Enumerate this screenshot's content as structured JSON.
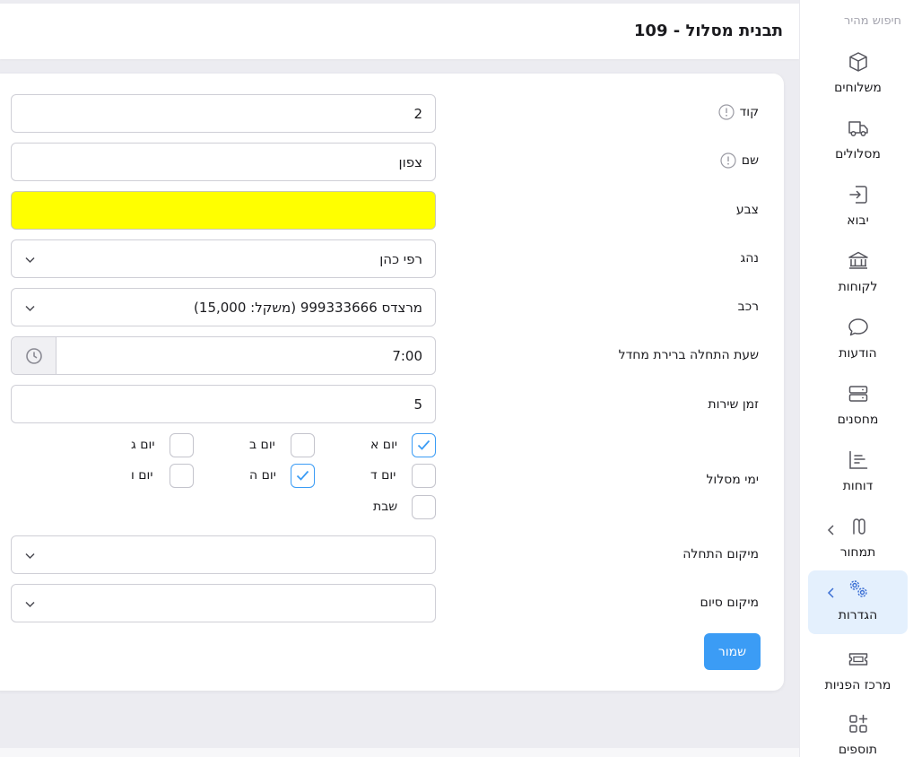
{
  "header": {
    "title": "תבנית מסלול - 109"
  },
  "sidebar": {
    "quick_search": "חיפוש מהיר",
    "items": [
      {
        "label": "משלוחים",
        "icon": "box-icon"
      },
      {
        "label": "מסלולים",
        "icon": "truck-icon"
      },
      {
        "label": "יבוא",
        "icon": "import-icon"
      },
      {
        "label": "לקוחות",
        "icon": "bank-icon"
      },
      {
        "label": "הודעות",
        "icon": "message-icon"
      },
      {
        "label": "מחסנים",
        "icon": "server-icon"
      },
      {
        "label": "דוחות",
        "icon": "report-icon"
      },
      {
        "label": "תמחור",
        "icon": "pricing-icon"
      },
      {
        "label": "הגדרות",
        "icon": "settings-icon",
        "active": true
      },
      {
        "label": "מרכז הפניות",
        "icon": "ticket-icon"
      },
      {
        "label": "תוספים",
        "icon": "plugins-icon"
      }
    ]
  },
  "form": {
    "code": {
      "label": "קוד",
      "value": "2"
    },
    "name": {
      "label": "שם",
      "value": "צפון"
    },
    "color": {
      "label": "צבע",
      "value": "#ffff00"
    },
    "driver": {
      "label": "נהג",
      "value": "רפי כהן"
    },
    "vehicle": {
      "label": "רכב",
      "value": "מרצדס 999333666 (משקל: 15,000)"
    },
    "start_time": {
      "label": "שעת התחלה ברירת מחדל",
      "value": "7:00"
    },
    "service_time": {
      "label": "זמן שירות",
      "value": "5"
    },
    "route_days": {
      "label": "ימי מסלול",
      "days": [
        {
          "label": "יום א",
          "checked": true
        },
        {
          "label": "יום ב",
          "checked": false
        },
        {
          "label": "יום ג",
          "checked": false
        },
        {
          "label": "יום ד",
          "checked": false
        },
        {
          "label": "יום ה",
          "checked": true
        },
        {
          "label": "יום ו",
          "checked": false
        },
        {
          "label": "שבת",
          "checked": false
        }
      ]
    },
    "start_location": {
      "label": "מיקום התחלה",
      "value": ""
    },
    "end_location": {
      "label": "מיקום סיום",
      "value": ""
    },
    "save_label": "שמור"
  },
  "colors": {
    "accent": "#3b9cf5",
    "active_bg": "#e4f0fd"
  }
}
